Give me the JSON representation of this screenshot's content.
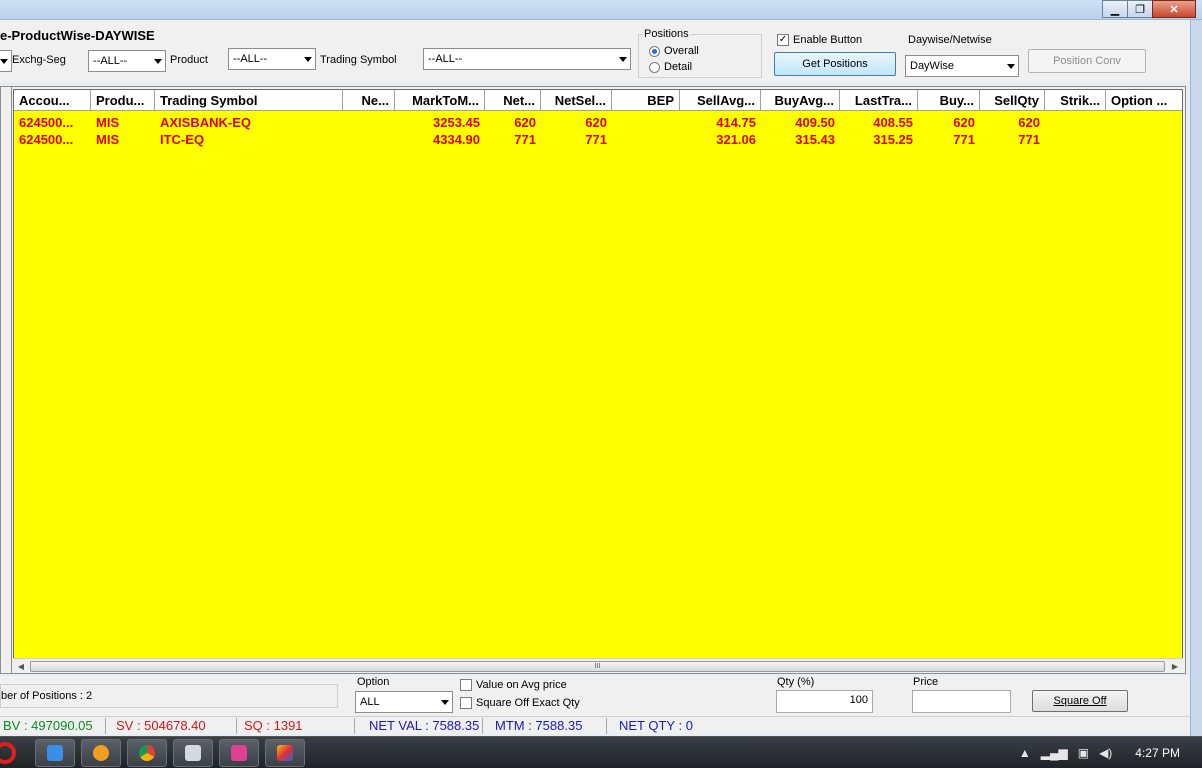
{
  "window": {
    "title": "",
    "controls": {
      "minimize": "▁",
      "maximize": "❐",
      "close": "✕"
    }
  },
  "page_title": "e-ProductWise-DAYWISE",
  "filters": {
    "exchange_label": "Exchg-Seg",
    "exchange_value": "--ALL--",
    "product_label": "Product",
    "product_value": "--ALL--",
    "symbol_label": "Trading Symbol",
    "symbol_value": "--ALL--"
  },
  "positions_group": {
    "label": "Positions",
    "overall_label": "Overall",
    "detail_label": "Detail",
    "selected": "Overall"
  },
  "enable_button": {
    "label": "Enable Button",
    "checked": true
  },
  "get_positions_label": "Get Positions",
  "daywise_group": {
    "label": "Daywise/Netwise",
    "value": "DayWise"
  },
  "position_conv_label": "Position Conv",
  "grid": {
    "columns": [
      "Accou...",
      "Produ...",
      "Trading Symbol",
      "Ne...",
      "MarkToM...",
      "Net...",
      "NetSel...",
      "BEP",
      "SellAvg...",
      "BuyAvg...",
      "LastTra...",
      "Buy...",
      "SellQty",
      "Strik...",
      "Option ..."
    ],
    "rows": [
      [
        "624500...",
        "MIS",
        "AXISBANK-EQ",
        "",
        "3253.45",
        "620",
        "620",
        "",
        "414.75",
        "409.50",
        "408.55",
        "620",
        "620",
        "",
        ""
      ],
      [
        "624500...",
        "MIS",
        "ITC-EQ",
        "",
        "4334.90",
        "771",
        "771",
        "",
        "321.06",
        "315.43",
        "315.25",
        "771",
        "771",
        "",
        ""
      ]
    ],
    "background_color": "#ffff00",
    "row_text_color": "#e00000"
  },
  "bottom": {
    "positions_count": "ber of Positions : 2",
    "option_label": "Option",
    "option_value": "ALL",
    "value_on_avg_label": "Value on Avg  price",
    "square_off_exact_label": "Square Off Exact Qty",
    "qty_label": "Qty (%)",
    "qty_value": "100",
    "price_label": "Price",
    "price_value": "",
    "square_off_label": "Square Off"
  },
  "status_bar": {
    "bv": "BV : 497090.05",
    "sv": "SV : 504678.40",
    "sq": "SQ : 1391",
    "net_val": "NET VAL : 7588.35",
    "mtm": "MTM : 7588.35",
    "net_qty": "NET QTY : 0"
  },
  "taskbar": {
    "clock": "4:27 PM",
    "apps": [
      "opera-icon",
      "app-icon",
      "media-player-icon",
      "chrome-icon",
      "calculator-icon",
      "paint-icon",
      "graphics-icon"
    ]
  }
}
